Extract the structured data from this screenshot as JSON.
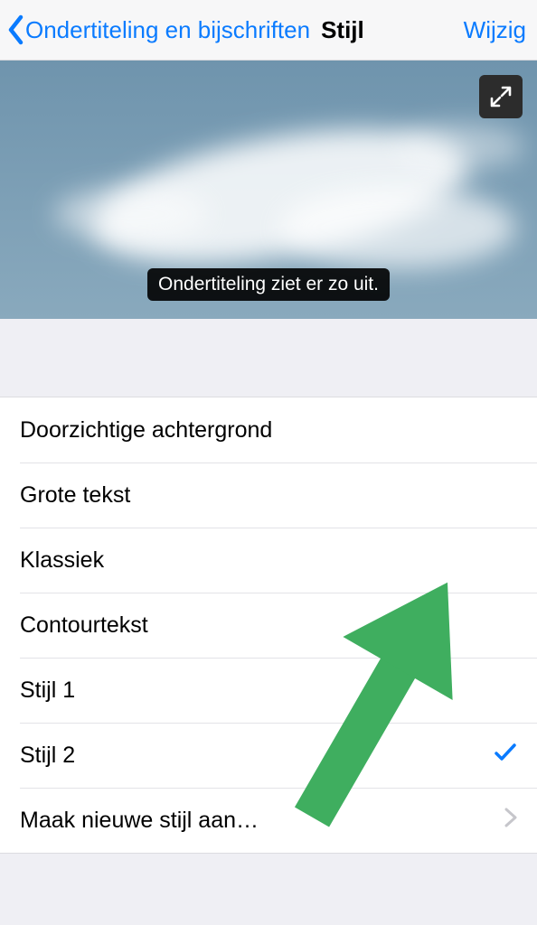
{
  "nav": {
    "back_label": "Ondertiteling en bijschriften",
    "title": "Stijl",
    "edit": "Wijzig"
  },
  "preview": {
    "sample_text": "Ondertiteling ziet er zo uit."
  },
  "styles": [
    {
      "label": "Doorzichtige achtergrond",
      "selected": false
    },
    {
      "label": "Grote tekst",
      "selected": false
    },
    {
      "label": "Klassiek",
      "selected": false
    },
    {
      "label": "Contourtekst",
      "selected": false
    },
    {
      "label": "Stijl 1",
      "selected": false
    },
    {
      "label": "Stijl 2",
      "selected": true
    }
  ],
  "create_new": "Maak nieuwe stijl aan…"
}
